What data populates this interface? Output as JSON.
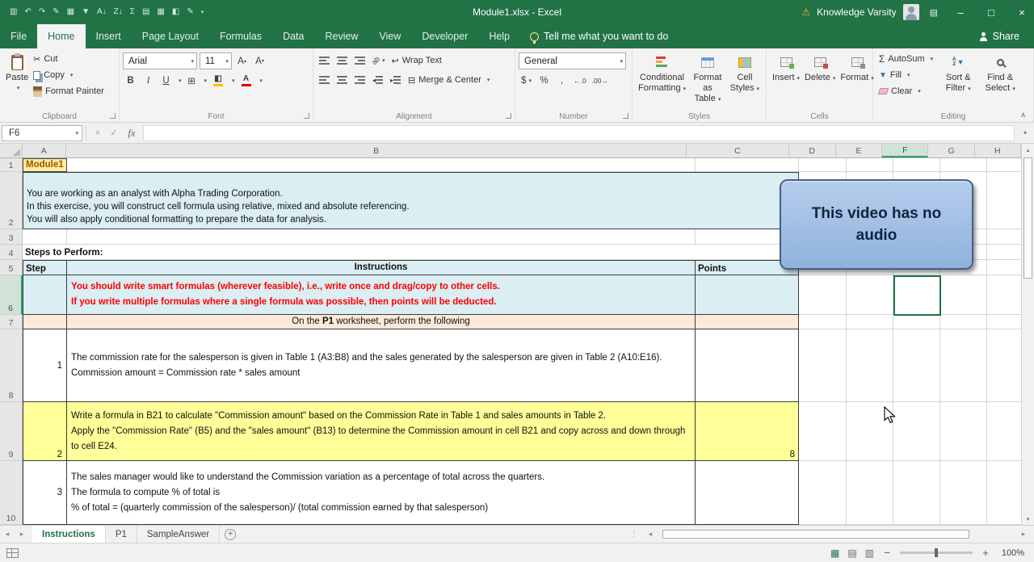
{
  "colors": {
    "excel_green": "#217346",
    "cell_blue": "#daeef3",
    "cell_peach": "#fde9d9",
    "cell_yellow": "#ffff99",
    "note_red": "#ff0000",
    "a1_fill": "#ffeb9c",
    "a1_text": "#9c5700",
    "overlay_border": "#44608a",
    "overlay_fill": "#9fbde4"
  },
  "titlebar": {
    "title": "Module1.xlsx - Excel",
    "notification": "Knowledge Varsity",
    "qat": [
      {
        "name": "save",
        "glyph": "▥"
      },
      {
        "name": "undo",
        "glyph": "↶"
      },
      {
        "name": "redo",
        "glyph": "↷"
      },
      {
        "name": "format-brush",
        "glyph": "✎"
      },
      {
        "name": "borders",
        "glyph": "▦"
      },
      {
        "name": "filter",
        "glyph": "▼"
      },
      {
        "name": "sort-ascending",
        "glyph": "A↓"
      },
      {
        "name": "sort-descending",
        "glyph": "Z↓"
      },
      {
        "name": "subtotal",
        "glyph": "Σ"
      },
      {
        "name": "freeze-panes",
        "glyph": "▤"
      },
      {
        "name": "insert-table",
        "glyph": "▦"
      },
      {
        "name": "fill-color",
        "glyph": "◧"
      },
      {
        "name": "ink-pen",
        "glyph": "✎"
      }
    ]
  },
  "ribbon_tabs": {
    "items": [
      "File",
      "Home",
      "Insert",
      "Page Layout",
      "Formulas",
      "Data",
      "Review",
      "View",
      "Developer",
      "Help"
    ],
    "active": "Home",
    "tell_me": "Tell me what you want to do",
    "share": "Share"
  },
  "ribbon": {
    "clipboard": {
      "label": "Clipboard",
      "paste": "Paste",
      "cut": "Cut",
      "copy": "Copy",
      "format_painter": "Format Painter"
    },
    "font": {
      "label": "Font",
      "family": "Arial",
      "size": "11",
      "bold": "B",
      "italic": "I",
      "underline": "U"
    },
    "alignment": {
      "label": "Alignment",
      "wrap_text": "Wrap Text",
      "merge_center": "Merge & Center"
    },
    "number": {
      "label": "Number",
      "format": "General",
      "currency": "$",
      "percent": "%",
      "comma": ","
    },
    "styles": {
      "label": "Styles",
      "conditional_formatting": "Conditional Formatting",
      "format_as_table": "Format as Table",
      "cell_styles": "Cell Styles"
    },
    "cells": {
      "label": "Cells",
      "insert": "Insert",
      "delete": "Delete",
      "format": "Format"
    },
    "editing": {
      "label": "Editing",
      "autosum": "AutoSum",
      "fill": "Fill",
      "clear": "Clear",
      "sort_filter": "Sort & Filter",
      "find_select": "Find & Select"
    }
  },
  "formula_bar": {
    "name_box": "F6",
    "function_label": "fx",
    "value": ""
  },
  "grid": {
    "columns": [
      "A",
      "B",
      "C",
      "D",
      "E",
      "F",
      "G",
      "H"
    ],
    "rows": [
      "1",
      "2",
      "3",
      "4",
      "5",
      "6",
      "7",
      "8",
      "9",
      "10"
    ],
    "active_cell": "F6"
  },
  "cells": {
    "a1": "Module1",
    "intro": [
      "You are working as an analyst with Alpha Trading Corporation.",
      "In this exercise, you will construct cell formula using relative, mixed and absolute referencing.",
      "You will also apply conditional formatting to prepare the data for analysis."
    ],
    "steps_heading": "Steps to Perform:",
    "table_headers": {
      "step": "Step",
      "instructions": "Instructions",
      "points": "Points"
    },
    "note": [
      "You should write smart formulas (wherever feasible), i.e., write once and drag/copy to other cells.",
      "If you write multiple formulas where a single formula was possible, then points will be deducted."
    ],
    "p1_row": {
      "prefix": "On the ",
      "sheet": "P1",
      "suffix": " worksheet, perform the following"
    },
    "steps": [
      {
        "num": "1",
        "lines": [
          "The commission rate for the salesperson is given in Table 1 (A3:B8) and the sales generated by the salesperson are given in Table 2 (A10:E16).",
          "Commission amount  = Commission rate * sales amount"
        ],
        "points": ""
      },
      {
        "num": "2",
        "lines": [
          "Write a formula in B21 to calculate \"Commission amount\" based on the Commission Rate in Table 1 and sales amounts in Table 2.",
          "Apply the \"Commission Rate\" (B5) and the \"sales amount\" (B13) to determine the Commission amount in cell B21 and copy across and down through to cell E24."
        ],
        "points": "8"
      },
      {
        "num": "3",
        "lines": [
          "The sales manager would like to understand the Commission variation as a percentage of total across the quarters.",
          "The formula to compute % of total is",
          "% of total = (quarterly commission of the salesperson)/ (total commission earned by that salesperson)"
        ],
        "points": ""
      }
    ]
  },
  "overlay": {
    "text": "This video has no audio"
  },
  "sheet_tabs": {
    "items": [
      "Instructions",
      "P1",
      "SampleAnswer"
    ],
    "active": "Instructions"
  },
  "status_bar": {
    "zoom": "100%"
  }
}
